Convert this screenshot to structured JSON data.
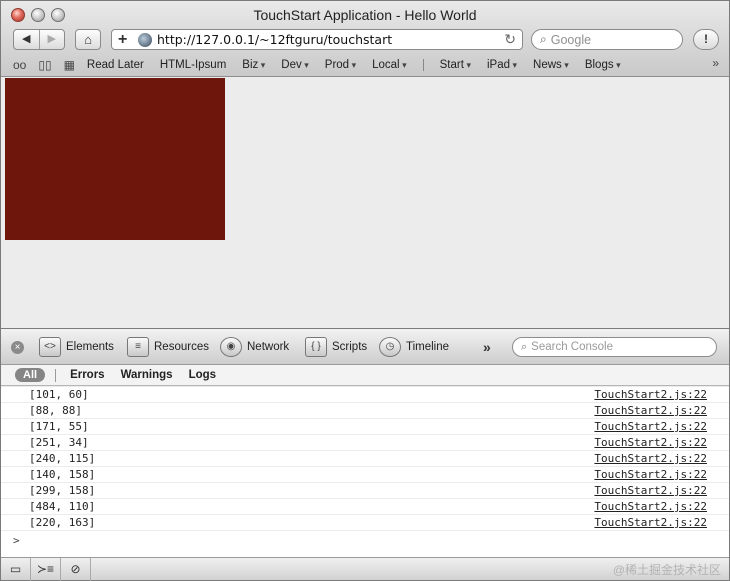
{
  "window": {
    "title": "TouchStart Application - Hello World"
  },
  "toolbar": {
    "back_icon": "back-arrow-icon",
    "forward_icon": "forward-arrow-icon",
    "home_icon": "home-icon",
    "add_icon": "plus-icon",
    "url": "http://127.0.0.1/~12ftguru/touchstart",
    "search_placeholder": "Google"
  },
  "bookmarks": {
    "items": [
      "Read Later",
      "HTML-Ipsum",
      "Biz",
      "Dev",
      "Prod",
      "Local",
      "Start",
      "iPad",
      "News",
      "Blogs"
    ]
  },
  "page": {
    "box_color": "#6e160c"
  },
  "inspector": {
    "tabs": [
      "Elements",
      "Resources",
      "Network",
      "Scripts",
      "Timeline"
    ],
    "more": "»",
    "search_placeholder": "Search Console"
  },
  "scope": {
    "all": "All",
    "errors": "Errors",
    "warnings": "Warnings",
    "logs": "Logs"
  },
  "console": {
    "rows": [
      {
        "message": "[101, 60]",
        "source": "TouchStart2.js:22"
      },
      {
        "message": "[88, 88]",
        "source": "TouchStart2.js:22"
      },
      {
        "message": "[171, 55]",
        "source": "TouchStart2.js:22"
      },
      {
        "message": "[251, 34]",
        "source": "TouchStart2.js:22"
      },
      {
        "message": "[240, 115]",
        "source": "TouchStart2.js:22"
      },
      {
        "message": "[140, 158]",
        "source": "TouchStart2.js:22"
      },
      {
        "message": "[299, 158]",
        "source": "TouchStart2.js:22"
      },
      {
        "message": "[484, 110]",
        "source": "TouchStart2.js:22"
      },
      {
        "message": "[220, 163]",
        "source": "TouchStart2.js:22"
      }
    ],
    "prompt": ">"
  },
  "watermark": "@稀土掘金技术社区"
}
